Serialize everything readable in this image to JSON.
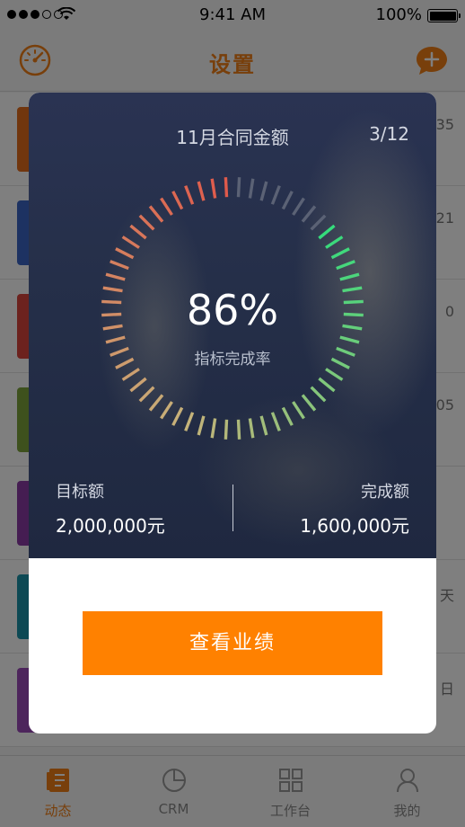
{
  "status_bar": {
    "time": "9:41 AM",
    "battery": "100%"
  },
  "navbar": {
    "title": "设置",
    "left_icon": "speedometer-icon",
    "right_icon": "chat-add-icon"
  },
  "list": {
    "rows": [
      {
        "color": "#e26d1c",
        "meta": "35"
      },
      {
        "color": "#3b65c5",
        "meta": "21"
      },
      {
        "color": "#d9453c",
        "meta": "0"
      },
      {
        "color": "#7da23a",
        "meta": "05"
      },
      {
        "color": "#8b3aa5",
        "meta": ""
      },
      {
        "color": "#1b93a8",
        "meta": "天"
      },
      {
        "color": "#9a4ab8",
        "meta": "日"
      }
    ]
  },
  "tabbar": {
    "tabs": [
      {
        "label": "动态",
        "icon": "doc-icon",
        "active": true
      },
      {
        "label": "CRM",
        "icon": "pie-icon",
        "active": false
      },
      {
        "label": "工作台",
        "icon": "grid-icon",
        "active": false
      },
      {
        "label": "我的",
        "icon": "user-icon",
        "active": false
      }
    ]
  },
  "modal": {
    "title": "11月合同金额",
    "page": "3/12",
    "percent_text": "86%",
    "percent_value": 0.86,
    "percent_label": "指标完成率",
    "target_label": "目标额",
    "target_value": "2,000,000元",
    "done_label": "完成额",
    "done_value": "1,600,000元",
    "button_label": "查看业绩",
    "colors": {
      "accent": "#ff8100",
      "tick_off": "#5b6275",
      "tick_start": "#e05a4b",
      "tick_mid": "#c7b27a",
      "tick_end": "#35dc7c"
    }
  }
}
